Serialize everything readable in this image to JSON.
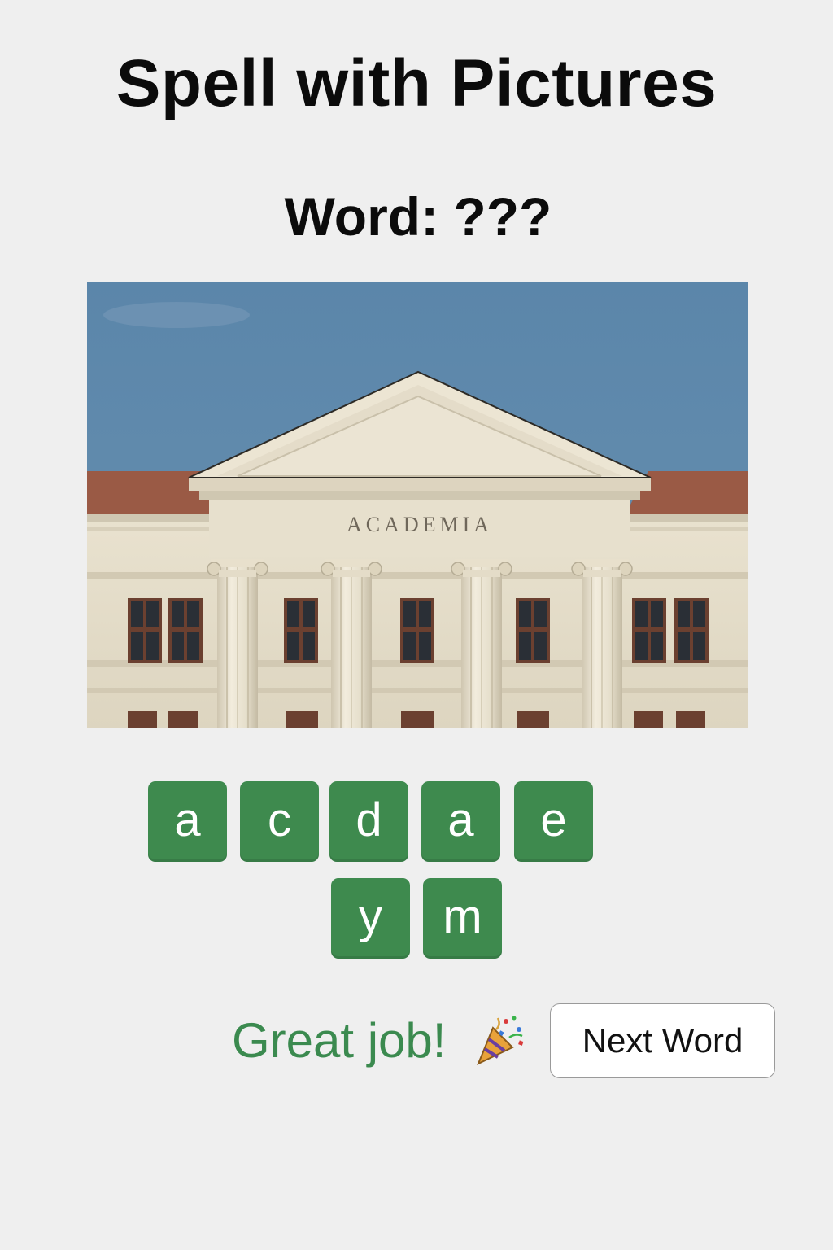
{
  "app": {
    "title": "Spell with Pictures"
  },
  "puzzle": {
    "word_prompt": "Word: ???",
    "picture": {
      "subject": "classical building",
      "inscription": "ACADEMIA"
    },
    "letter_tiles": [
      {
        "letter": "a"
      },
      {
        "letter": "c"
      },
      {
        "letter": "d"
      },
      {
        "letter": "a"
      },
      {
        "letter": "e"
      },
      {
        "letter": "y"
      },
      {
        "letter": "m"
      }
    ]
  },
  "feedback": {
    "message": "Great job!",
    "icon": "party-popper-icon"
  },
  "controls": {
    "next_label": "Next Word"
  },
  "colors": {
    "tile": "#3e8a4e",
    "success_text": "#3b8a4f",
    "background": "#efefef"
  }
}
